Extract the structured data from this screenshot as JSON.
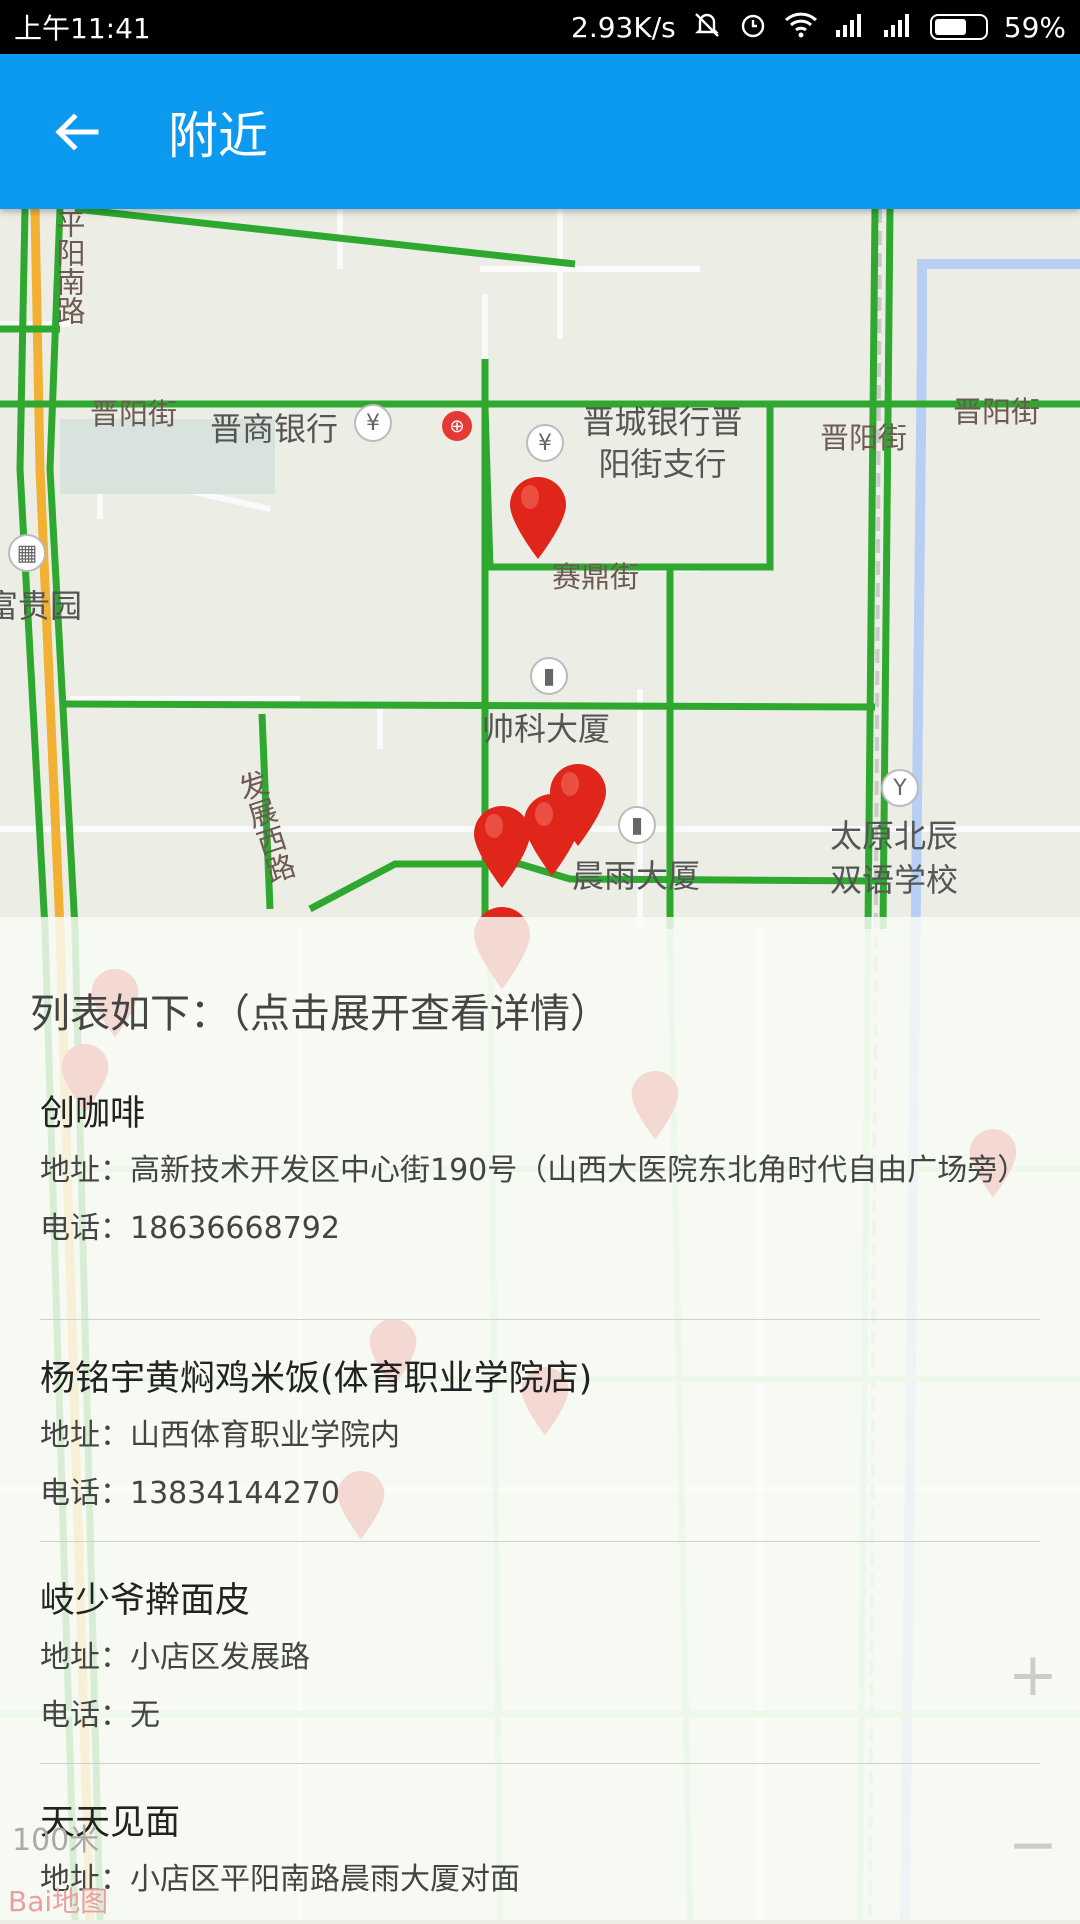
{
  "status_bar": {
    "time": "上午11:41",
    "net_speed": "2.93K/s",
    "battery_text": "59%",
    "battery_level": 0.59,
    "icons": [
      "mute-icon",
      "alarm-icon",
      "wifi-icon",
      "signal-icon",
      "signal-icon",
      "battery-icon"
    ]
  },
  "appbar": {
    "back_icon": "arrow-left-icon",
    "title": "附近",
    "color": "#0b9af0"
  },
  "map": {
    "labels": {
      "pingyang_nan_lu": "平阳南路",
      "jinyang_jie_w": "晋阳街",
      "jinshang_bank": "晋商银行",
      "jincheng_bank": "晋城银行晋阳街支行",
      "jinyang_jie_mid": "晋阳街",
      "jinyang_jie_e": "晋阳街",
      "fuguiyuan": "富贵园",
      "saiding_jie": "赛鼎街",
      "shuaike_dasha": "帅科大厦",
      "fazhan_xi_lu": "发展西路",
      "chenyu_dasha": "晨雨大厦",
      "school": "太原北辰双语学校"
    },
    "scale": "100米",
    "logo": "Bai地图",
    "zoom_in": "+",
    "zoom_out": "−"
  },
  "list": {
    "heading": "列表如下：（点击展开查看详情）",
    "address_label": "地址：",
    "phone_label": "电话：",
    "items": [
      {
        "name": "创咖啡",
        "address": "高新技术开发区中心街190号（山西大医院东北角时代自由广场旁）",
        "phone": "18636668792"
      },
      {
        "name": "杨铭宇黄焖鸡米饭(体育职业学院店)",
        "address": "山西体育职业学院内",
        "phone": "13834144270"
      },
      {
        "name": "岐少爷擀面皮",
        "address": "小店区发展路",
        "phone": "无"
      },
      {
        "name": "天天见面",
        "address": "小店区平阳南路晨雨大厦对面",
        "phone": ""
      }
    ]
  }
}
